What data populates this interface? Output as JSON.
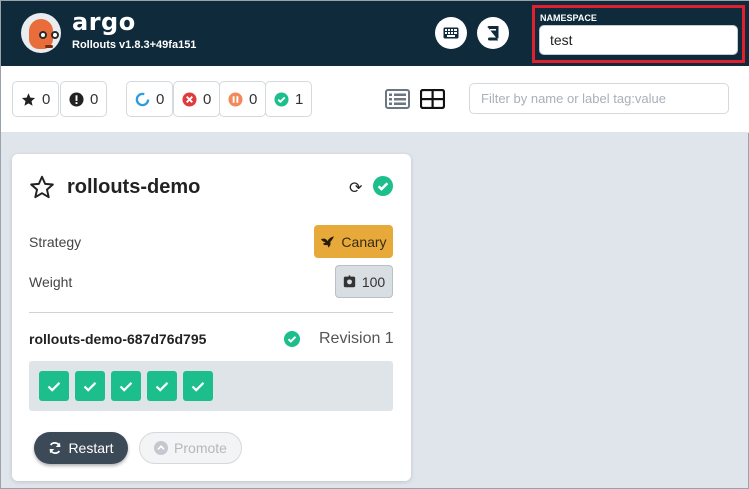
{
  "header": {
    "brand": "argo",
    "version": "Rollouts v1.8.3+49fa151",
    "namespace_label": "NAMESPACE",
    "namespace_value": "test",
    "icons": [
      "keyboard-icon",
      "book-icon"
    ]
  },
  "filters": {
    "favorites": "0",
    "warnings": "0",
    "progressing": "0",
    "degraded": "0",
    "paused": "0",
    "healthy": "1",
    "search_placeholder": "Filter by name or label tag:value"
  },
  "rollout": {
    "name": "rollouts-demo",
    "strategy_label": "Strategy",
    "strategy_value": "Canary",
    "weight_label": "Weight",
    "weight_value": "100",
    "replicaset": {
      "name": "rollouts-demo-687d76d795",
      "revision": "Revision 1",
      "pods": [
        "healthy",
        "healthy",
        "healthy",
        "healthy",
        "healthy"
      ]
    },
    "restart_label": "Restart",
    "promote_label": "Promote"
  },
  "colors": {
    "header_bg": "#0f2b3b",
    "healthy": "#1cbf8c",
    "degraded": "#e03b3b",
    "paused": "#f08a5d",
    "progressing": "#2f9be0",
    "canary": "#e7a93a",
    "highlight": "#e0202f"
  }
}
